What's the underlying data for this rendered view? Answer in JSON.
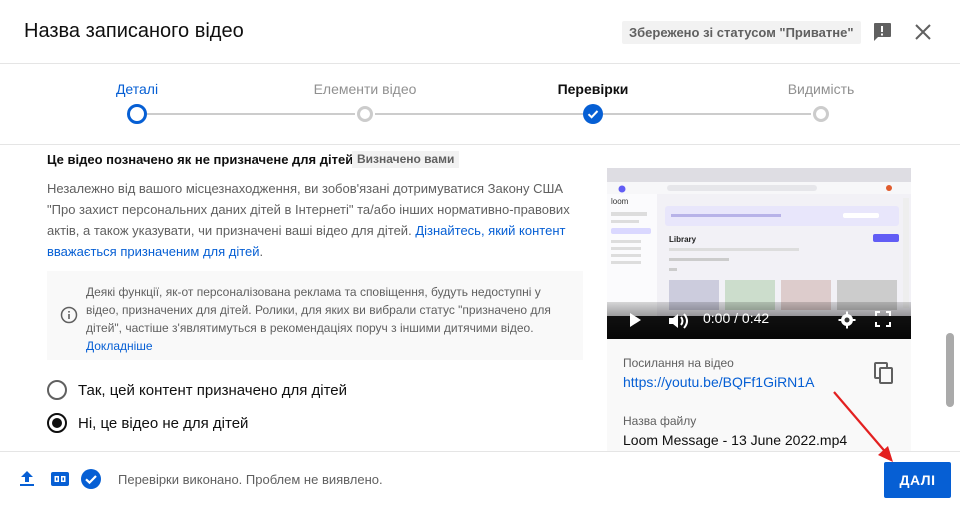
{
  "header": {
    "title": "Назва записаного відео",
    "saved_status": "Збережено зі статусом \"Приватне\""
  },
  "stepper": {
    "steps": [
      {
        "label": "Деталі",
        "state": "active"
      },
      {
        "label": "Елементи відео",
        "state": "pending"
      },
      {
        "label": "Перевірки",
        "state": "done"
      },
      {
        "label": "Видимість",
        "state": "pending"
      }
    ]
  },
  "audience": {
    "heading": "Це відео позначено як не призначене для дітей",
    "badge": "Визначено вами",
    "description": "Незалежно від вашого місцезнаходження, ви зобов'язані дотримуватися Закону США \"Про захист персональних даних дітей в Інтернеті\" та/або інших нормативно-правових актів, а також указувати, чи призначені ваші відео для дітей.",
    "learn_link": "Дізнайтесь, який контент вважається призначеним для дітей",
    "info_text": "Деякі функції, як-от персоналізована реклама та сповіщення, будуть недоступні у відео, призначених для дітей. Ролики, для яких ви вибрали статус \"призначено для дітей\", частіше з'являтимуться в рекомендаціях поруч з іншими дитячими відео.",
    "info_link": "Докладніше",
    "options": [
      {
        "label": "Так, цей контент призначено для дітей",
        "checked": false
      },
      {
        "label": "Ні, це відео не для дітей",
        "checked": true
      }
    ]
  },
  "preview": {
    "time": "0:00 / 0:42",
    "link_label": "Посилання на відео",
    "video_url": "https://youtu.be/BQFf1GiRN1A",
    "file_label": "Назва файлу",
    "file_name": "Loom Message - 13 June 2022.mp4",
    "screen": {
      "app_name": "loom",
      "library_title": "Library"
    }
  },
  "footer": {
    "status": "Перевірки виконано. Проблем не виявлено.",
    "next_label": "ДАЛІ"
  },
  "colors": {
    "accent": "#065fd4",
    "annotation_arrow": "#e32020"
  }
}
